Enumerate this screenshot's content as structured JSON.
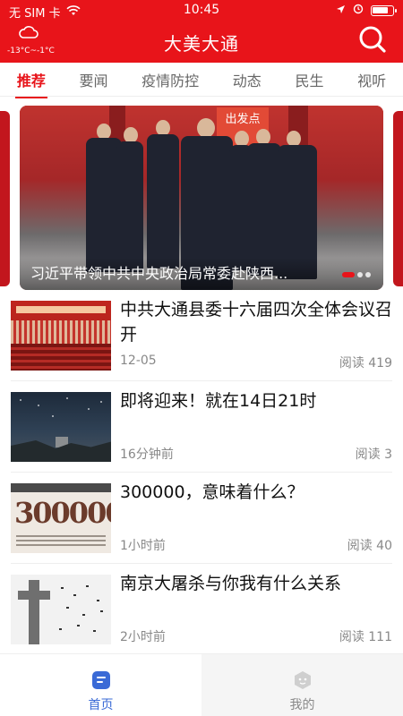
{
  "status": {
    "carrier": "无 SIM 卡",
    "time": "10:45"
  },
  "header": {
    "title": "大美大通",
    "weather_temp": "-13°C~-1°C"
  },
  "tabs": [
    "推荐",
    "要闻",
    "疫情防控",
    "动态",
    "民生",
    "视听"
  ],
  "carousel": {
    "caption": "习近平带领中共中央政治局常委赴陕西...",
    "sign_text": "出发点",
    "slide_count": 3,
    "active_index": 0
  },
  "news": [
    {
      "title": "中共大通县委十六届四次全体会议召开",
      "time": "12-05",
      "reads": "阅读 419"
    },
    {
      "title": "即将迎来！就在14日21时",
      "time": "16分钟前",
      "reads": "阅读 3"
    },
    {
      "title": "300000，意味着什么？",
      "time": "1小时前",
      "reads": "阅读 40"
    },
    {
      "title": "南京大屠杀与你我有什么关系",
      "time": "2小时前",
      "reads": "阅读 111"
    }
  ],
  "thumb3": {
    "number": "300000"
  },
  "bottom_nav": {
    "home_label": "首页",
    "mine_label": "我的"
  },
  "colors": {
    "brand": "#E8141A",
    "nav_active": "#3a6ad6"
  }
}
